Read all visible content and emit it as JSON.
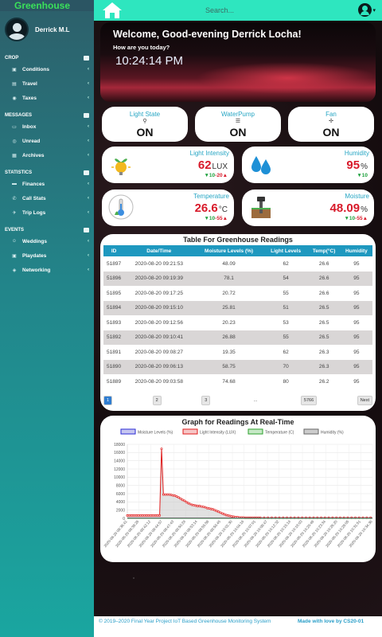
{
  "sidebar": {
    "brand": "Greenhouse",
    "user": "Derrick M.L",
    "sections": [
      {
        "label": "CROP",
        "items": [
          "Conditions",
          "Travel",
          "Taxes"
        ]
      },
      {
        "label": "MESSAGES",
        "items": [
          "Inbox",
          "Unread",
          "Archives"
        ]
      },
      {
        "label": "STATISTICS",
        "items": [
          "Finances",
          "Call Stats",
          "Trip Logs"
        ]
      },
      {
        "label": "EVENTS",
        "items": [
          "Weddings",
          "Playdates",
          "Networking"
        ]
      }
    ]
  },
  "header": {
    "search_placeholder": "Search..."
  },
  "welcome": {
    "greeting": "Welcome, Good-evening Derrick Locha!",
    "subtitle": "How are you today?",
    "time": "10:24:14 PM"
  },
  "states": [
    {
      "title": "Light State",
      "icon": "lightbulb-icon",
      "value": "ON"
    },
    {
      "title": "WaterPump",
      "icon": "pump-icon",
      "value": "ON"
    },
    {
      "title": "Fan",
      "icon": "fan-icon",
      "value": "ON"
    }
  ],
  "sensors": {
    "light": {
      "title": "Light Intensity",
      "value": "62",
      "unit": "LUX",
      "low": "10",
      "high": "20"
    },
    "humidity": {
      "title": "Humidity",
      "value": "95",
      "unit": "%",
      "low": "10",
      "high": ""
    },
    "temperature": {
      "title": "Temperature",
      "value": "26.6",
      "unit": "°C",
      "low": "10",
      "high": "55"
    },
    "moisture": {
      "title": "Moisture",
      "value": "48.09",
      "unit": "%",
      "low": "10",
      "high": "55"
    }
  },
  "table": {
    "title": "Table For Greenhouse Readings",
    "headers": [
      "ID",
      "Date/Time",
      "Moisture Levels (%)",
      "Light Levels",
      "Temp(°C)",
      "Humidity"
    ],
    "rows": [
      [
        "51897",
        "2020-08-20 09:21:53",
        "48.09",
        "62",
        "26.6",
        "95"
      ],
      [
        "51896",
        "2020-08-20 09:19:39",
        "78.1",
        "54",
        "26.6",
        "95"
      ],
      [
        "51895",
        "2020-08-20 09:17:25",
        "20.72",
        "55",
        "26.6",
        "95"
      ],
      [
        "51894",
        "2020-08-20 09:15:10",
        "25.81",
        "51",
        "26.5",
        "95"
      ],
      [
        "51893",
        "2020-08-20 09:12:56",
        "20.23",
        "53",
        "26.5",
        "95"
      ],
      [
        "51892",
        "2020-08-20 09:10:41",
        "26.88",
        "55",
        "26.5",
        "95"
      ],
      [
        "51891",
        "2020-08-20 09:08:27",
        "19.35",
        "62",
        "26.3",
        "95"
      ],
      [
        "51890",
        "2020-08-20 09:06:13",
        "58.75",
        "70",
        "26.3",
        "95"
      ],
      [
        "51889",
        "2020-08-20 09:03:58",
        "74.68",
        "80",
        "26.2",
        "95"
      ]
    ],
    "pager": [
      "1",
      "2",
      "3",
      "...",
      "5766",
      "Next"
    ]
  },
  "chart_data": {
    "type": "line",
    "title": "Graph for Readings At Real-Time",
    "legend": [
      "Moisture Levels (%)",
      "Light Intensity (LUX)",
      "Temperature (C)",
      "Humidity (%)"
    ],
    "legend_placement": "top",
    "ylim": [
      0,
      18000
    ],
    "yticks": [
      0,
      2000,
      4000,
      6000,
      8000,
      10000,
      12000,
      14000,
      16000,
      18000
    ],
    "xtick_labels": [
      "2020-08-20 09:36:41",
      "2020-08-20 09:39:26",
      "2020-08-20 09:42:12",
      "2020-08-20 09:44:57",
      "2020-08-20 09:47:43",
      "2020-08-20 09:50:28",
      "2020-08-20 09:53:14",
      "2020-08-20 09:55:59",
      "2020-08-20 09:58:45",
      "2020-08-20 10:01:30",
      "2020-08-20 10:04:16",
      "2020-08-20 10:07:01",
      "2020-08-20 10:09:47",
      "2020-08-20 10:12:32",
      "2020-08-20 10:15:18",
      "2020-08-20 10:18:03",
      "2020-08-20 10:20:49",
      "2020-08-20 10:23:34",
      "2020-08-20 10:26:20",
      "2020-08-20 10:29:05",
      "2020-08-20 10:31:51",
      "2020-08-20 10:34:36"
    ],
    "series": [
      {
        "name": "Light Intensity (LUX)",
        "color": "#e01b1b",
        "values": [
          700,
          700,
          700,
          700,
          700,
          700,
          700,
          700,
          700,
          700,
          700,
          700,
          700,
          700,
          700,
          700,
          700,
          700,
          16900,
          5800,
          5800,
          5800,
          5800,
          5700,
          5600,
          5500,
          5300,
          5100,
          4800,
          4500,
          4300,
          4000,
          3700,
          3500,
          3300,
          3200,
          3100,
          3000,
          3000,
          2900,
          2800,
          2700,
          2500,
          2400,
          2300,
          2200,
          2000,
          1800,
          1600,
          1400,
          1200,
          1000,
          800,
          700,
          600,
          500,
          400,
          300,
          300,
          200,
          200,
          200,
          150,
          150,
          150,
          150,
          150,
          150,
          150,
          150,
          150,
          150,
          150,
          150,
          150,
          150,
          150,
          150,
          150,
          150,
          150,
          150,
          150,
          150,
          150,
          150,
          150,
          150,
          150,
          150,
          150,
          150,
          150,
          150,
          150,
          150,
          150,
          150,
          150,
          150,
          150,
          150,
          150,
          150,
          150,
          150,
          150,
          150,
          150,
          150,
          150,
          150,
          150,
          150,
          150,
          150,
          150,
          150,
          150,
          150,
          150,
          150,
          150,
          150,
          150,
          150,
          150,
          150,
          150,
          150
        ]
      },
      {
        "name": "Moisture Levels (%)",
        "color": "#2b2bd6",
        "values": [
          50,
          50
        ]
      },
      {
        "name": "Temperature (C)",
        "color": "#2aa02a",
        "values": [
          26,
          26
        ]
      },
      {
        "name": "Humidity (%)",
        "color": "#666666",
        "values": [
          95,
          95
        ]
      }
    ]
  },
  "footer": {
    "left": "© 2019–2020 Final Year Project IoT Based Greenhouse Monitoring System",
    "right": "Made with love by CS20-01"
  }
}
